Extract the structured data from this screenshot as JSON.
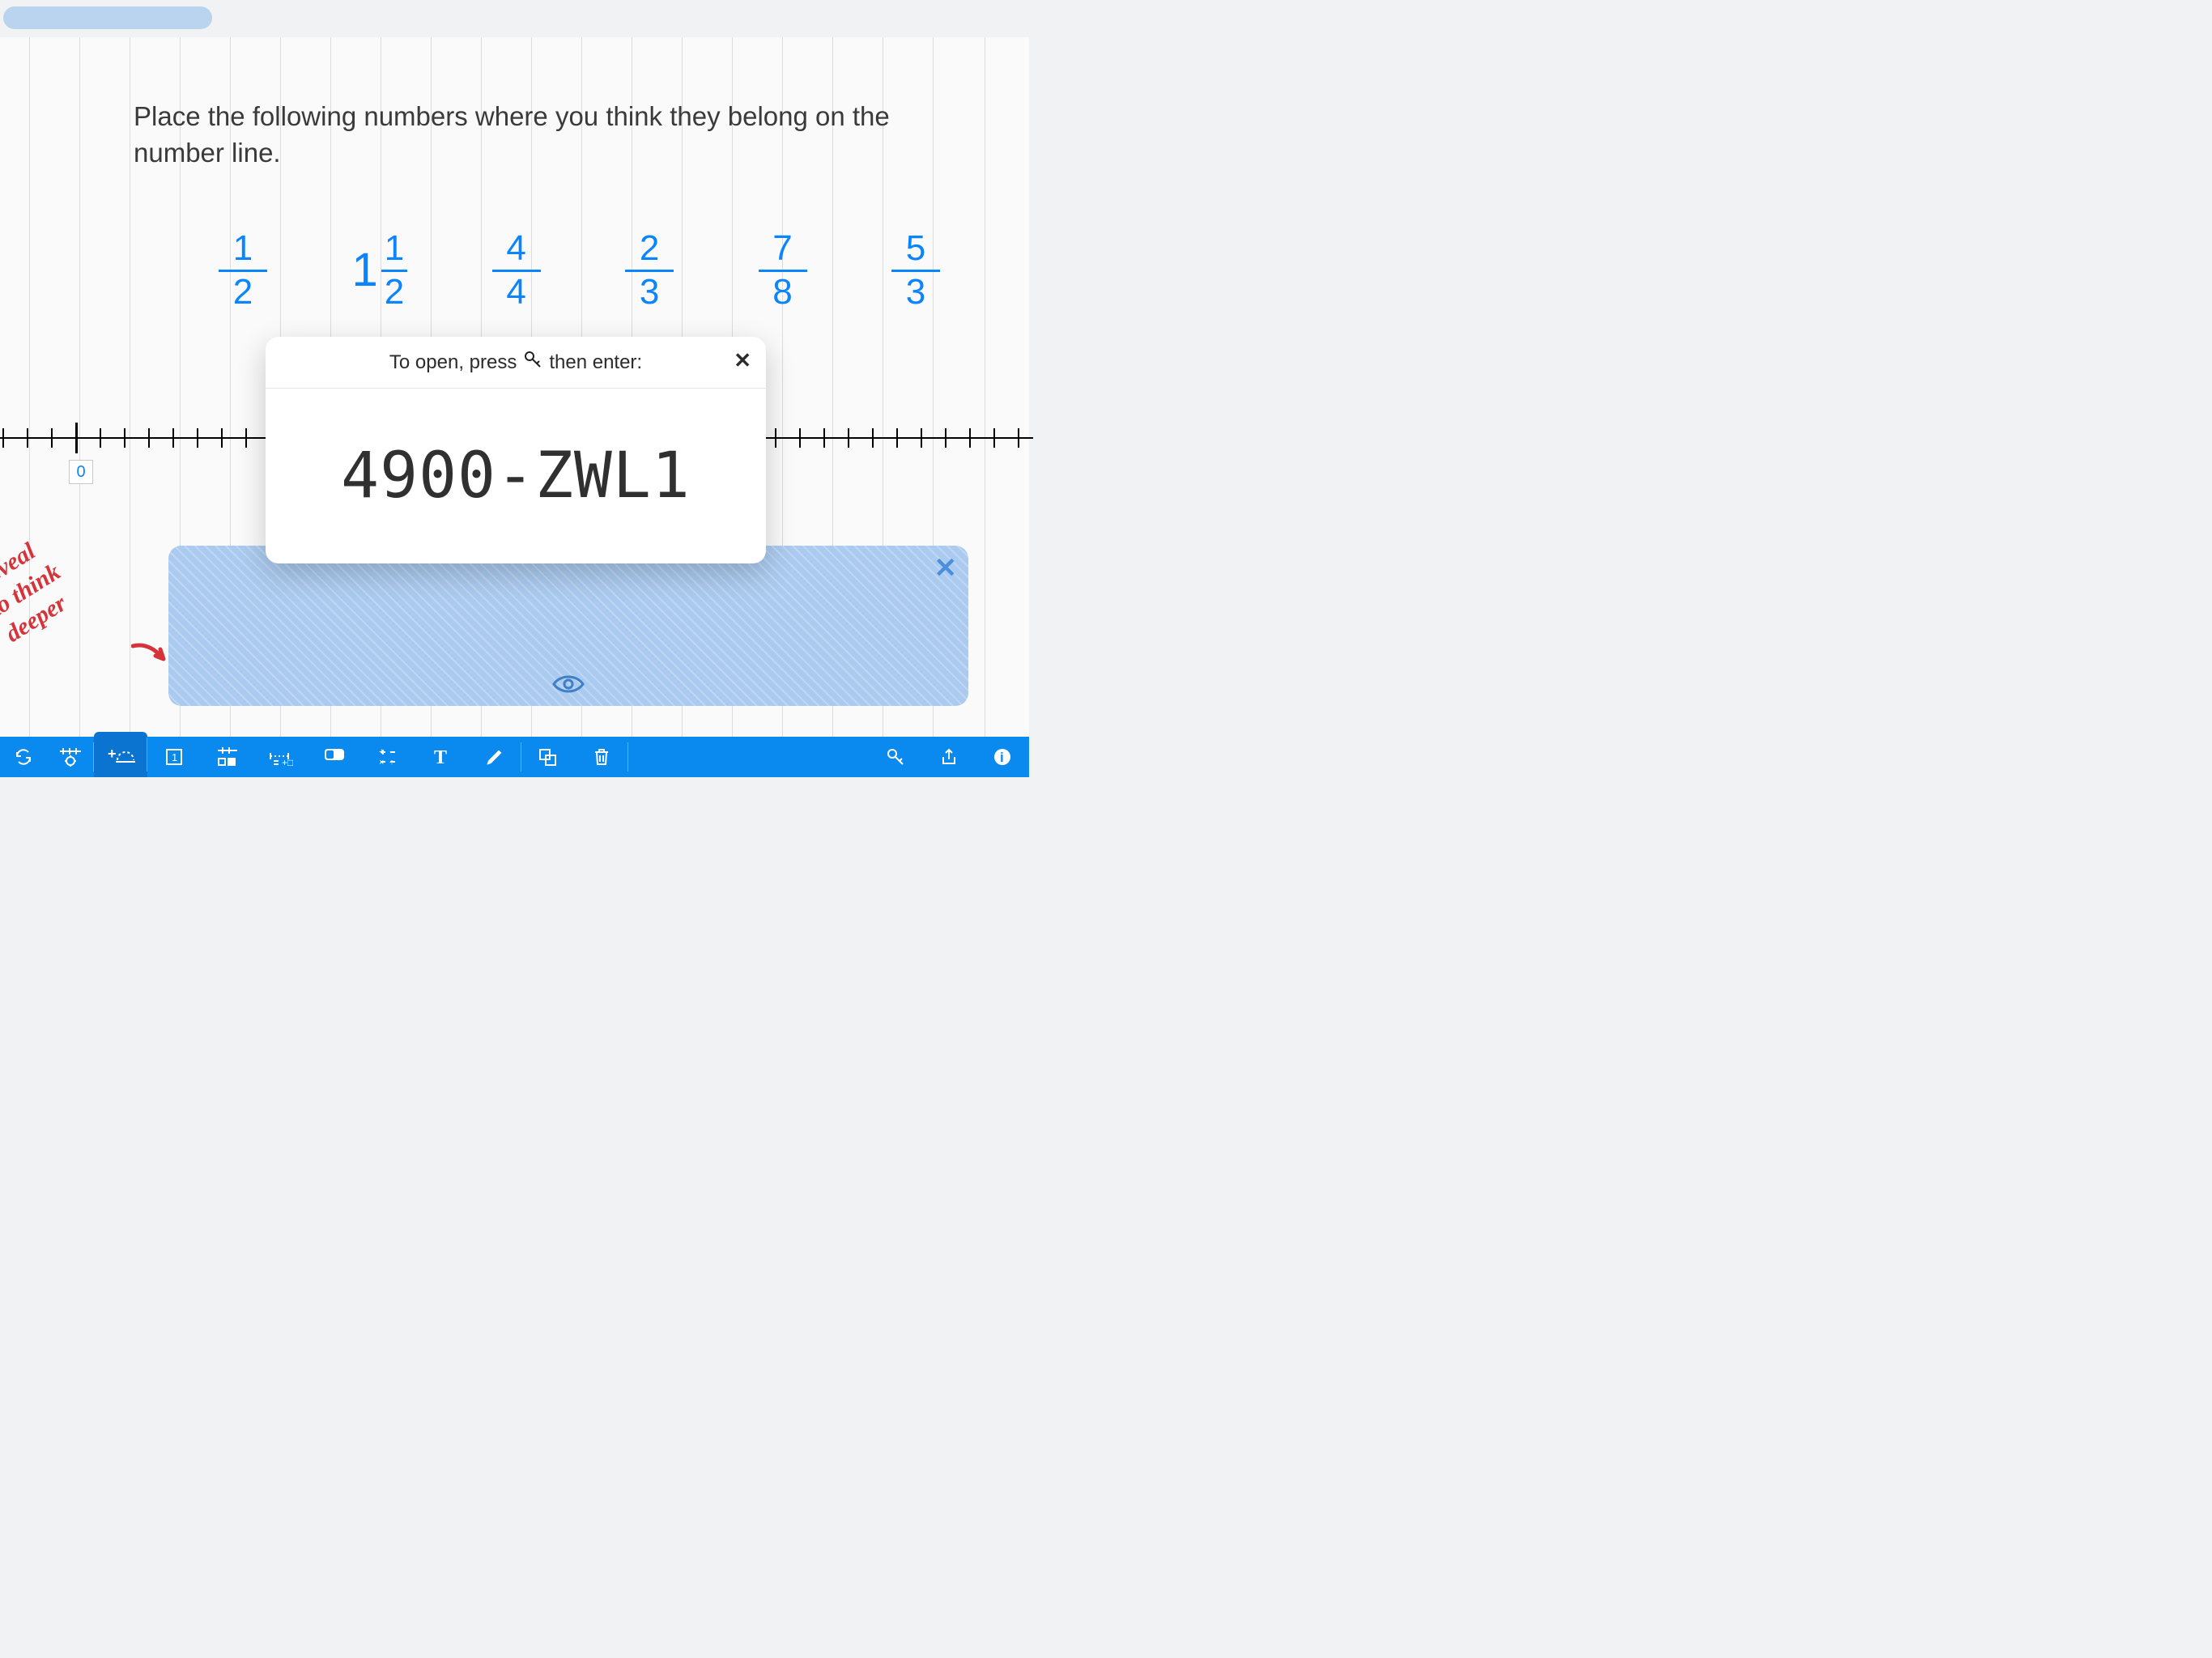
{
  "prompt": "Place the following numbers where you think they belong on the number line.",
  "fractions": [
    {
      "whole": "",
      "num": "1",
      "den": "2"
    },
    {
      "whole": "1",
      "num": "1",
      "den": "2"
    },
    {
      "whole": "",
      "num": "4",
      "den": "4"
    },
    {
      "whole": "",
      "num": "2",
      "den": "3"
    },
    {
      "whole": "",
      "num": "7",
      "den": "8"
    },
    {
      "whole": "",
      "num": "5",
      "den": "3"
    }
  ],
  "number_line": {
    "zero_label": "0"
  },
  "handwritten": {
    "line1": "Reveal",
    "line2": "to think",
    "line3": "deeper"
  },
  "popup": {
    "prefix": "To open, press",
    "suffix": "then enter:",
    "code": "4900-ZWL1"
  },
  "hidden_panel": {
    "visible": true
  },
  "toolbar_icons": [
    "sync-icon",
    "number-line-settings-icon",
    "add-arc-icon",
    "unit-box-icon",
    "grid-icon",
    "ruler-icon",
    "fraction-bar-icon",
    "operations-icon",
    "text-icon",
    "pencil-icon",
    "sep",
    "duplicate-icon",
    "trash-icon",
    "sep",
    "key-icon",
    "share-icon",
    "info-icon"
  ]
}
